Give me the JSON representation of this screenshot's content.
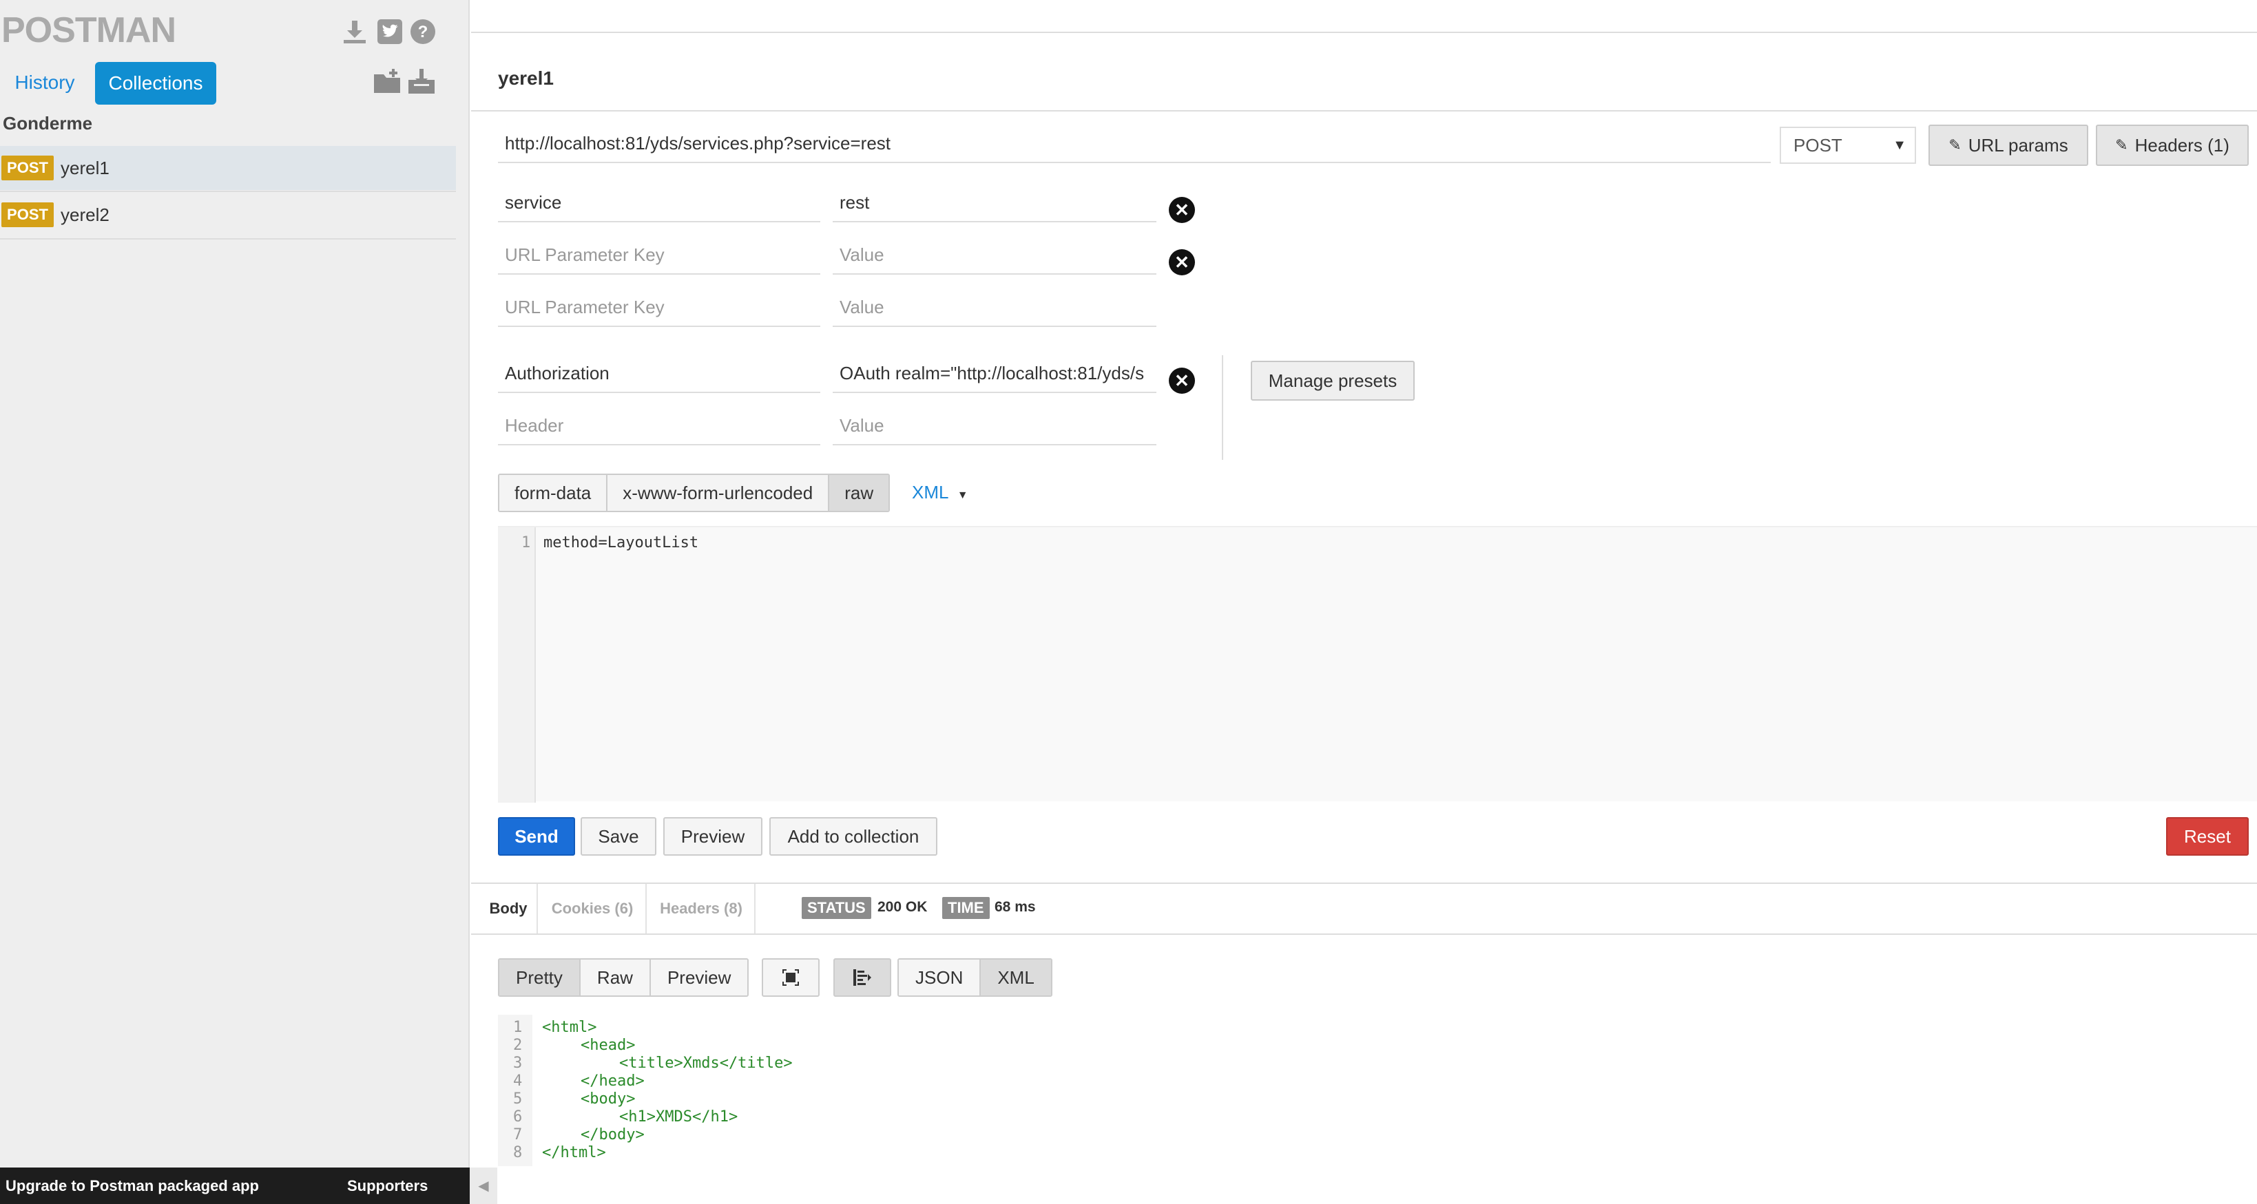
{
  "sidebar": {
    "logo": "POSTMAN",
    "icons": [
      "download-icon",
      "twitter-icon",
      "help-icon"
    ],
    "tabs": [
      {
        "label": "History"
      },
      {
        "label": "Collections"
      }
    ],
    "collection_icons": [
      "new-folder-icon",
      "import-icon"
    ],
    "collection_name": "Gonderme",
    "requests": [
      {
        "method": "POST",
        "name": "yerel1"
      },
      {
        "method": "POST",
        "name": "yerel2"
      }
    ],
    "footer": {
      "upgrade": "Upgrade to Postman packaged app",
      "supporters": "Supporters"
    }
  },
  "request": {
    "title": "yerel1",
    "url": "http://localhost:81/yds/services.php?service=rest",
    "method": "POST",
    "url_params_label": "URL params",
    "headers_label": "Headers (1)",
    "params": [
      {
        "key": "service",
        "value": "rest"
      },
      {
        "key_placeholder": "URL Parameter Key",
        "value_placeholder": "Value"
      },
      {
        "key_placeholder": "URL Parameter Key",
        "value_placeholder": "Value"
      }
    ],
    "headers": [
      {
        "key": "Authorization",
        "value": "OAuth realm=\"http://localhost:81/yds/s"
      },
      {
        "key_placeholder": "Header",
        "value_placeholder": "Value"
      }
    ],
    "manage_presets": "Manage presets",
    "body_modes": [
      "form-data",
      "x-www-form-urlencoded",
      "raw"
    ],
    "body_mode_selected": "raw",
    "raw_type": "XML",
    "body_lines": [
      {
        "n": "1",
        "text": "method=LayoutList"
      }
    ],
    "actions": {
      "send": "Send",
      "save": "Save",
      "preview": "Preview",
      "add_to_collection": "Add to collection",
      "reset": "Reset"
    }
  },
  "response": {
    "tabs": [
      "Body",
      "Cookies (6)",
      "Headers (8)"
    ],
    "status_label": "STATUS",
    "status_value": "200 OK",
    "time_label": "TIME",
    "time_value": "68 ms",
    "view_modes": [
      "Pretty",
      "Raw",
      "Preview"
    ],
    "formats": [
      "JSON",
      "XML"
    ],
    "lines": [
      {
        "n": "1",
        "indent": 0,
        "text": "<html>"
      },
      {
        "n": "2",
        "indent": 1,
        "text": "<head>"
      },
      {
        "n": "3",
        "indent": 2,
        "text": "<title>Xmds</title>"
      },
      {
        "n": "4",
        "indent": 1,
        "text": "</head>"
      },
      {
        "n": "5",
        "indent": 1,
        "text": "<body>"
      },
      {
        "n": "6",
        "indent": 2,
        "text": "<h1>XMDS</h1>"
      },
      {
        "n": "7",
        "indent": 1,
        "text": "</body>"
      },
      {
        "n": "8",
        "indent": 0,
        "text": "</html>"
      }
    ]
  },
  "colors": {
    "accent": "#108ed1",
    "post_badge": "#d4a017",
    "send": "#1a6ed8",
    "reset": "#d7403a"
  }
}
